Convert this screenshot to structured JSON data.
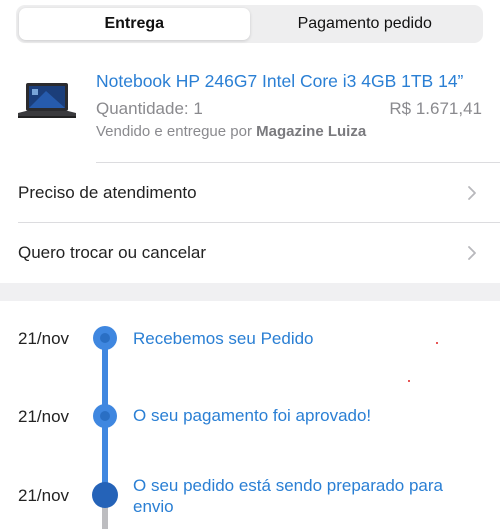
{
  "tabs": [
    {
      "label": "Entrega",
      "active": true
    },
    {
      "label": "Pagamento pedido",
      "active": false
    }
  ],
  "product": {
    "title": "Notebook HP 246G7 Intel Core i3 4GB 1TB 14”",
    "quantity": "Quantidade: 1",
    "price": "R$ 1.671,41",
    "seller_prefix": "Vendido e entregue por ",
    "seller_name": "Magazine Luiza"
  },
  "actions": [
    {
      "label": "Preciso de atendimento"
    },
    {
      "label": "Quero trocar ou cancelar"
    }
  ],
  "timeline": [
    {
      "date": "21/nov",
      "text": "Recebemos seu Pedido"
    },
    {
      "date": "21/nov",
      "text": "O seu pagamento foi aprovado!"
    },
    {
      "date": "21/nov",
      "text": "O seu pedido está sendo preparado para envio"
    }
  ],
  "colors": {
    "accent": "#2a7fd4",
    "timeline_active": "#3f87e0",
    "timeline_current": "#2563b8",
    "timeline_pending": "#bdbdc0",
    "muted": "#8a8a8e"
  }
}
